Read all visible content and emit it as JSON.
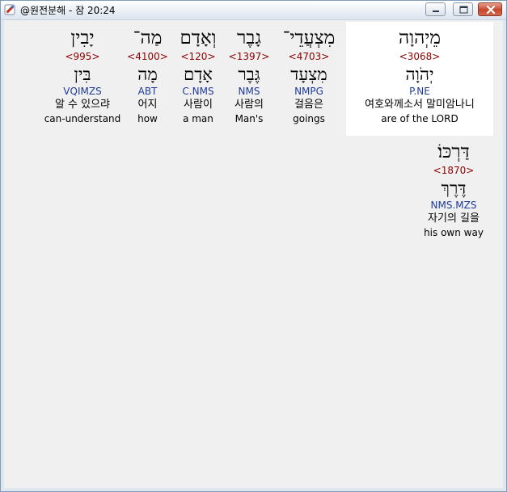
{
  "window": {
    "title": "@원전분해 - 잠 20:24"
  },
  "words": [
    {
      "hebrew": "מֵיְהוָה",
      "strong": "<3068>",
      "lemma": "יְהֹוָה",
      "parse": "P.NE",
      "korean": "여호와께소서 말미암나니",
      "english": "are of the LORD",
      "selected": true
    },
    {
      "hebrew": "מִצְעֲדֵי־",
      "strong": "<4703>",
      "lemma": "מִצְעָד",
      "parse": "NMPG",
      "korean": "걸음은",
      "english": "goings"
    },
    {
      "hebrew": "גָבֶר",
      "strong": "<1397>",
      "lemma": "גֶּבֶר",
      "parse": "NMS",
      "korean": "사람의",
      "english": "Man's"
    },
    {
      "hebrew": "וְאָדָם",
      "strong": "<120>",
      "lemma": "אָדָם",
      "parse": "C.NMS",
      "korean": "사람이",
      "english": "a man"
    },
    {
      "hebrew": "מַה־",
      "strong": "<4100>",
      "lemma": "מָה",
      "parse": "ABT",
      "korean": "어지",
      "english": "how"
    },
    {
      "hebrew": "יָבִין",
      "strong": "<995>",
      "lemma": "בִּין",
      "parse": "VQIMZS",
      "korean": "알 수 있으랴",
      "english": "can-understand"
    },
    {
      "hebrew": "דַּרְכּוֹ׃",
      "strong": "<1870>",
      "lemma": "דֶּרֶךְ",
      "parse": "NMS.MZS",
      "korean": "자기의 길을",
      "english": "his own way"
    }
  ],
  "colors": {
    "strong_number": "#8b0000",
    "parse_code": "#1f3b9a",
    "selection_background": "#ffffff",
    "client_background": "#f0f0f0"
  },
  "icons": {
    "app": "hebrew-bible-app-icon",
    "minimize": "minimize-icon",
    "maximize": "maximize-icon",
    "close": "close-icon"
  }
}
